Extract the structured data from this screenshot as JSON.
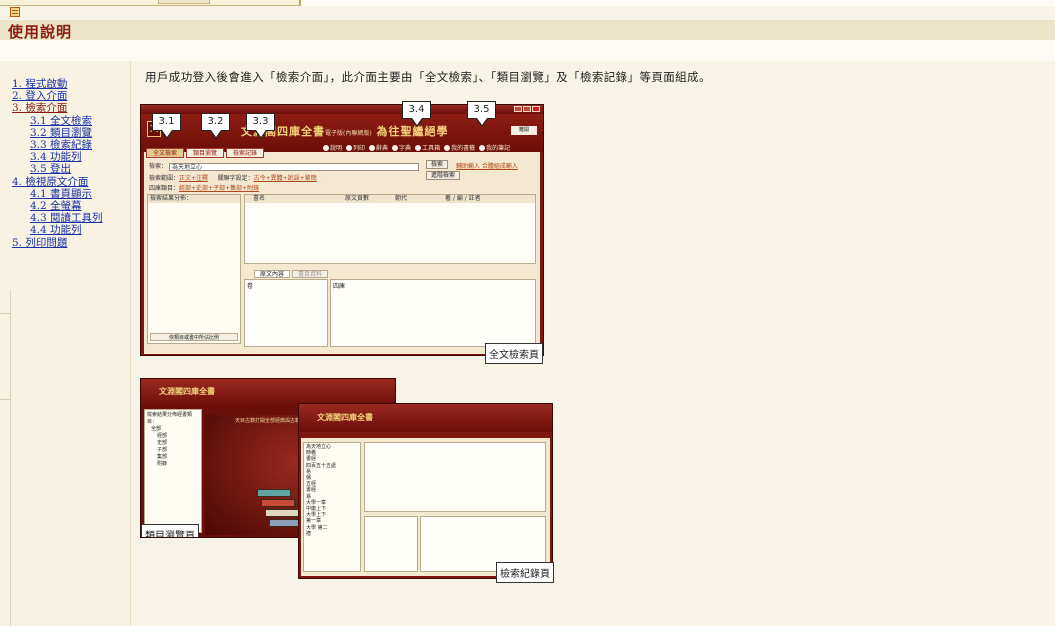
{
  "header": {
    "title": "使用說明"
  },
  "nav": {
    "items": [
      {
        "label": "1. 程式啟動",
        "level": 1
      },
      {
        "label": "2. 登入介面",
        "level": 1
      },
      {
        "label": "3. 檢索介面",
        "level": 1,
        "current": true
      },
      {
        "label": "3.1 全文檢索",
        "level": 2
      },
      {
        "label": "3.2 類目瀏覽",
        "level": 2
      },
      {
        "label": "3.3 檢索紀錄",
        "level": 2
      },
      {
        "label": "3.4 功能列",
        "level": 2
      },
      {
        "label": "3.5 登出",
        "level": 2
      },
      {
        "label": "4. 檢視原文介面",
        "level": 1
      },
      {
        "label": "4.1 書頁顯示",
        "level": 2
      },
      {
        "label": "4.2 全螢幕",
        "level": 2
      },
      {
        "label": "4.3 閱讀工具列",
        "level": 2
      },
      {
        "label": "4.4 功能列",
        "level": 2
      },
      {
        "label": "5. 列印問題",
        "level": 1
      }
    ]
  },
  "content": {
    "intro": "用戶成功登入後會進入「檢索介面」，此介面主要由「全文檢索」、「類目瀏覽」及「檢索記錄」等頁面組成。",
    "figure1": {
      "brand": "文淵閣四庫全書",
      "brand_sub": "電子版(內聯網版)",
      "brand_tail": "為往聖繼絕學",
      "toolbar": [
        "說明",
        "列印",
        "辭典",
        "字典",
        "工具箱",
        "我的書籤",
        "我的筆記"
      ],
      "exit_label": "離開",
      "tabs": [
        "全文檢索",
        "類目瀏覽",
        "檢索記錄"
      ],
      "search_label": "檢索：",
      "search_value": "為天地立心",
      "scope_label": "檢索範圍：",
      "scope_value": "正文+注釋",
      "keyword_label": "關聯字設定：",
      "keyword_value": "古今+異體+訛誤+繁簡",
      "category_label": "四庫類目：",
      "category_value": "經部+史部+子部+集部+附錄",
      "search_button": "檢索",
      "advanced_button": "進階檢索",
      "right_links": "輔助輸入  合體組成輸入",
      "result_label": "檢索結果分佈：",
      "grid_headers": [
        "書名",
        "原文頁數",
        "朝代",
        "著 / 編 / 註者"
      ],
      "detail_tabs": [
        "原文內容",
        "書目資料"
      ],
      "detail_label_left": "卷",
      "detail_label_right": "四庫",
      "left_footer": "依類目或書中所佔比例",
      "callouts": [
        "3.1",
        "3.2",
        "3.3",
        "3.4",
        "3.5"
      ],
      "caption": "全文檢索頁"
    },
    "figure2": {
      "banner": "天目古籍打開全部經典與古籍等一覽表",
      "tree": [
        "檢索結果分佈經書類目：",
        "全部",
        "經部",
        "史部",
        "子部",
        "集部",
        "附錄"
      ],
      "caption": "類目瀏覽頁"
    },
    "figure3": {
      "list": [
        "為天地立心",
        "時義",
        "書經",
        "四百五十五處",
        "易",
        "儒",
        "五經",
        "書經",
        "易",
        "大學一章",
        "中庸上下",
        "大學上下",
        "第一章",
        "大學 第二",
        "禮"
      ],
      "caption": "檢索紀錄頁"
    }
  },
  "colors": {
    "accent": "#8b1a10",
    "link": "#1a31a8",
    "background": "#f7f3e6",
    "app_frame": "#7d1710"
  }
}
